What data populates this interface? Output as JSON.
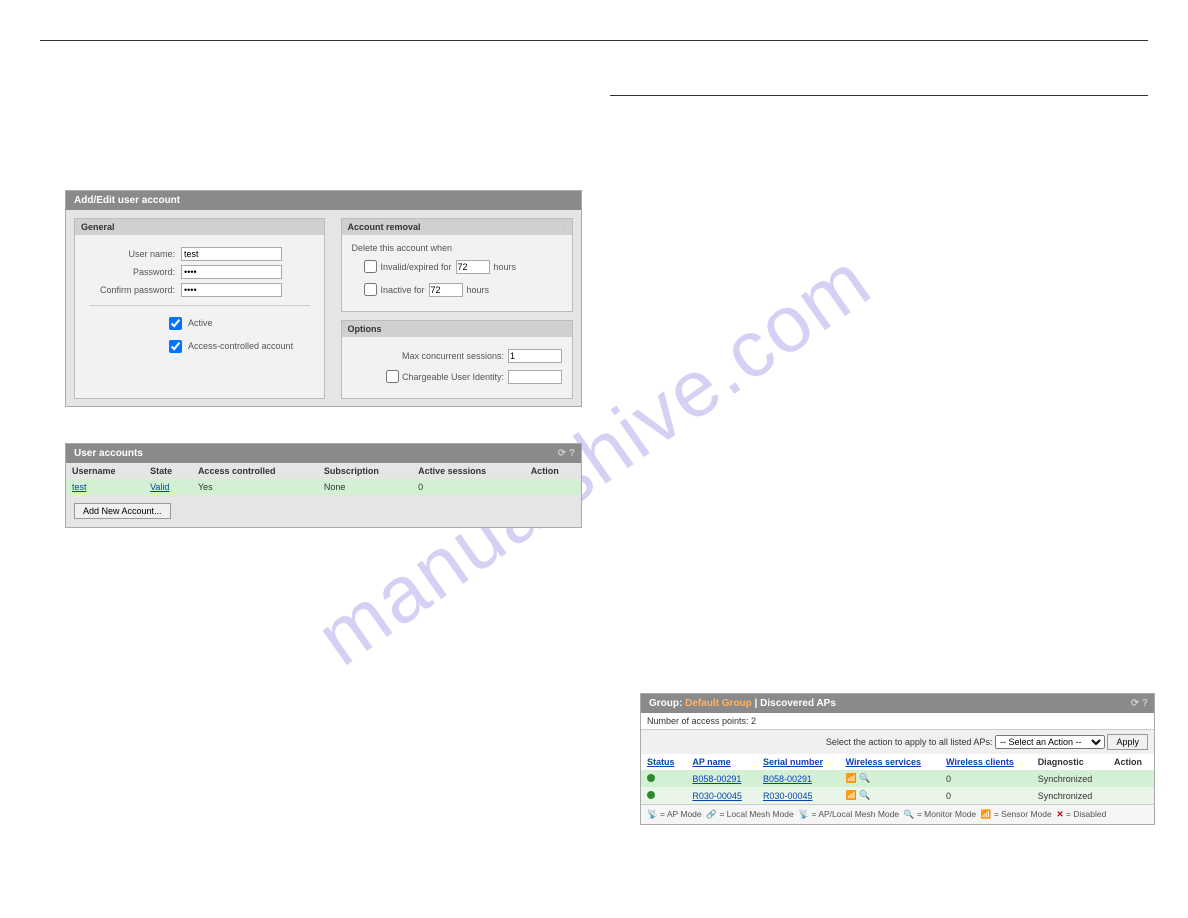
{
  "watermark": "manualshive.com",
  "addEdit": {
    "title": "Add/Edit user account",
    "general": {
      "header": "General",
      "username_label": "User name:",
      "username_value": "test",
      "password_label": "Password:",
      "password_value": "••••",
      "confirm_label": "Confirm password:",
      "confirm_value": "••••",
      "active_label": "Active",
      "access_controlled_label": "Access-controlled account"
    },
    "removal": {
      "header": "Account removal",
      "intro": "Delete this account when",
      "invalid_label_pre": "Invalid/expired for",
      "invalid_value": "72",
      "inactive_label_pre": "Inactive for",
      "inactive_value": "72",
      "hours_suffix": "hours"
    },
    "options": {
      "header": "Options",
      "max_sessions_label": "Max concurrent sessions:",
      "max_sessions_value": "1",
      "chargeable_label": "Chargeable User Identity:"
    }
  },
  "userAccounts": {
    "title": "User accounts",
    "headers": {
      "username": "Username",
      "state": "State",
      "access": "Access controlled",
      "subscription": "Subscription",
      "active": "Active sessions",
      "action": "Action"
    },
    "rows": [
      {
        "username": "test",
        "state": "Valid",
        "access": "Yes",
        "subscription": "None",
        "active": "0"
      }
    ],
    "add_btn": "Add New Account..."
  },
  "discoveredAPs": {
    "title_prefix": "Group: ",
    "group_name": "Default Group",
    "title_suffix": " | Discovered APs",
    "count_label": "Number of access points: 2",
    "action_label": "Select the action to apply to all listed APs:",
    "action_selected": "-- Select an Action --",
    "apply_btn": "Apply",
    "headers": {
      "status": "Status",
      "apname": "AP name",
      "serial": "Serial number",
      "wservices": "Wireless services",
      "wclients": "Wireless clients",
      "diag": "Diagnostic",
      "action": "Action"
    },
    "rows": [
      {
        "apname": "B058-00291",
        "serial": "B058-00291",
        "clients": "0",
        "diag": "Synchronized"
      },
      {
        "apname": "R030-00045",
        "serial": "R030-00045",
        "clients": "0",
        "diag": "Synchronized"
      }
    ],
    "legend": {
      "ap": "= AP Mode",
      "lm": "= Local Mesh Mode",
      "aplm": "= AP/Local Mesh Mode",
      "mon": "= Monitor Mode",
      "sen": "= Sensor Mode",
      "dis": "= Disabled"
    }
  }
}
